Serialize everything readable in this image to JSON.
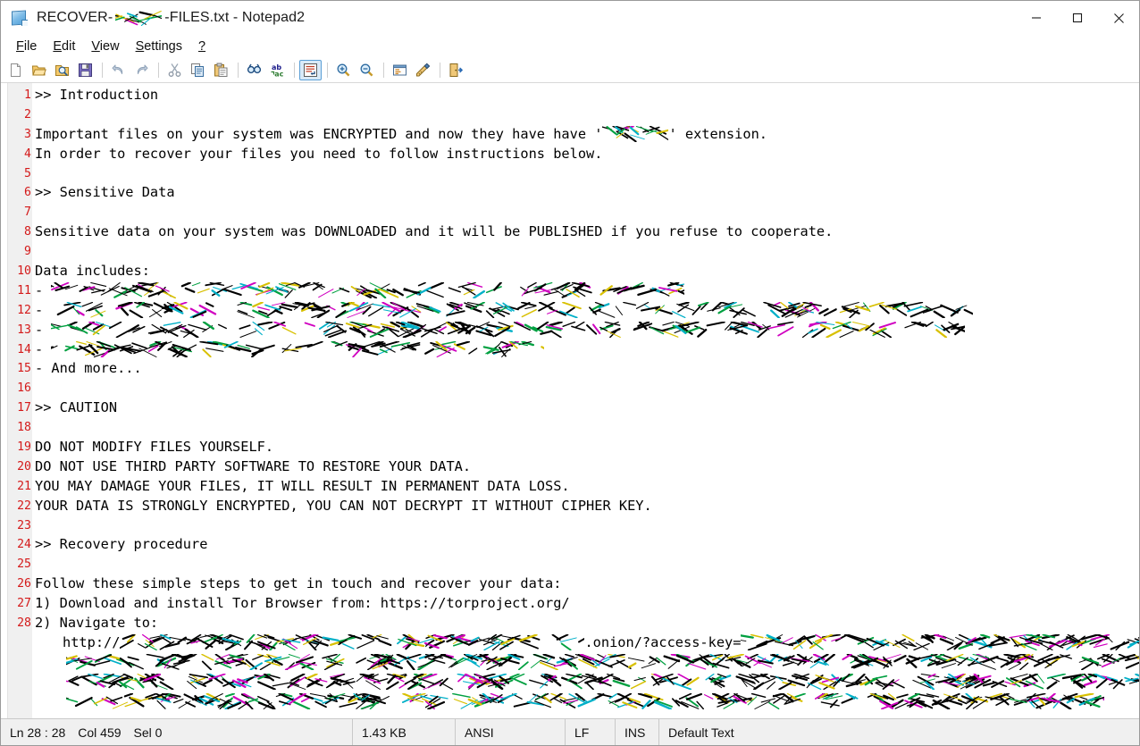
{
  "window": {
    "title_prefix": "RECOVER-",
    "title_suffix": "-FILES.txt - Notepad2",
    "icon": "notepad2-document-icon",
    "buttons": {
      "minimize": "minimize-icon",
      "maximize": "maximize-icon",
      "close": "close-icon"
    }
  },
  "menu": {
    "items": [
      {
        "label": "File",
        "accel": "F"
      },
      {
        "label": "Edit",
        "accel": "E"
      },
      {
        "label": "View",
        "accel": "V"
      },
      {
        "label": "Settings",
        "accel": "S"
      },
      {
        "label": "?",
        "accel": "?"
      }
    ]
  },
  "toolbar": {
    "buttons": [
      {
        "name": "new-file-icon",
        "checked": false
      },
      {
        "name": "open-file-icon",
        "checked": false
      },
      {
        "name": "browse-file-icon",
        "checked": false
      },
      {
        "name": "save-file-icon",
        "checked": false
      },
      {
        "separator": true
      },
      {
        "name": "undo-icon",
        "checked": false
      },
      {
        "name": "redo-icon",
        "checked": false
      },
      {
        "separator": true
      },
      {
        "name": "cut-icon",
        "checked": false
      },
      {
        "name": "copy-icon",
        "checked": false
      },
      {
        "name": "paste-icon",
        "checked": false
      },
      {
        "separator": true
      },
      {
        "name": "find-icon",
        "checked": false
      },
      {
        "name": "replace-icon",
        "checked": false
      },
      {
        "separator": true
      },
      {
        "name": "word-wrap-icon",
        "checked": true
      },
      {
        "separator": true
      },
      {
        "name": "zoom-in-icon",
        "checked": false
      },
      {
        "name": "zoom-out-icon",
        "checked": false
      },
      {
        "separator": true
      },
      {
        "name": "scheme-options-icon",
        "checked": false
      },
      {
        "name": "customize-schemes-icon",
        "checked": false
      },
      {
        "separator": true
      },
      {
        "name": "exit-icon",
        "checked": false
      }
    ]
  },
  "editor": {
    "line_numbers": [
      "1",
      "2",
      "3",
      "4",
      "5",
      "6",
      "7",
      "8",
      "9",
      "10",
      "11",
      "12",
      "13",
      "14",
      "15",
      "16",
      "17",
      "18",
      "19",
      "20",
      "21",
      "22",
      "23",
      "24",
      "25",
      "26",
      "27",
      "28"
    ],
    "lines": [
      {
        "n": "1",
        "text": ">> Introduction"
      },
      {
        "n": "2",
        "text": ""
      },
      {
        "n": "3",
        "text": "Important files on your system was ENCRYPTED and now they have have '",
        "redacted": true,
        "text_after": "' extension."
      },
      {
        "n": "4",
        "text": "In order to recover your files you need to follow instructions below."
      },
      {
        "n": "5",
        "text": ""
      },
      {
        "n": "6",
        "text": ">> Sensitive Data"
      },
      {
        "n": "7",
        "text": ""
      },
      {
        "n": "8",
        "text": "Sensitive data on your system was DOWNLOADED and it will be PUBLISHED if you refuse to cooperate."
      },
      {
        "n": "9",
        "text": ""
      },
      {
        "n": "10",
        "text": "Data includes:"
      },
      {
        "n": "11",
        "text": "- ",
        "redacted_full": true
      },
      {
        "n": "12",
        "text": "- ",
        "redacted_full": true
      },
      {
        "n": "13",
        "text": "- ",
        "redacted_full": true
      },
      {
        "n": "14",
        "text": "- ",
        "redacted_full": true
      },
      {
        "n": "15",
        "text": "- And more..."
      },
      {
        "n": "16",
        "text": ""
      },
      {
        "n": "17",
        "text": ">> CAUTION"
      },
      {
        "n": "18",
        "text": ""
      },
      {
        "n": "19",
        "text": "DO NOT MODIFY FILES YOURSELF."
      },
      {
        "n": "20",
        "text": "DO NOT USE THIRD PARTY SOFTWARE TO RESTORE YOUR DATA."
      },
      {
        "n": "21",
        "text": "YOU MAY DAMAGE YOUR FILES, IT WILL RESULT IN PERMANENT DATA LOSS."
      },
      {
        "n": "22",
        "text": "YOUR DATA IS STRONGLY ENCRYPTED, YOU CAN NOT DECRYPT IT WITHOUT CIPHER KEY."
      },
      {
        "n": "23",
        "text": ""
      },
      {
        "n": "24",
        "text": ">> Recovery procedure"
      },
      {
        "n": "25",
        "text": ""
      },
      {
        "n": "26",
        "text": "Follow these simple steps to get in touch and recover your data:"
      },
      {
        "n": "27",
        "text": "1) Download and install Tor Browser from: https://torproject.org/"
      },
      {
        "n": "28",
        "text": "2) Navigate to:"
      }
    ],
    "wrapped_url": {
      "scheme": "http://",
      "middle_visible": ".onion/?access-key=",
      "redacted": true
    }
  },
  "statusbar": {
    "position": "Ln 28 : 28",
    "column": "Col 459",
    "selection": "Sel 0",
    "filesize": "1.43 KB",
    "encoding": "ANSI",
    "line_endings": "LF",
    "insert_mode": "INS",
    "scheme": "Default Text"
  },
  "colors": {
    "line_number": "#d41a1a",
    "gutter_bg": "#f0f0f0",
    "text": "#000000",
    "toolbar_checked": "#d9eaf8",
    "statusbar_bg": "#f0f0f0"
  }
}
